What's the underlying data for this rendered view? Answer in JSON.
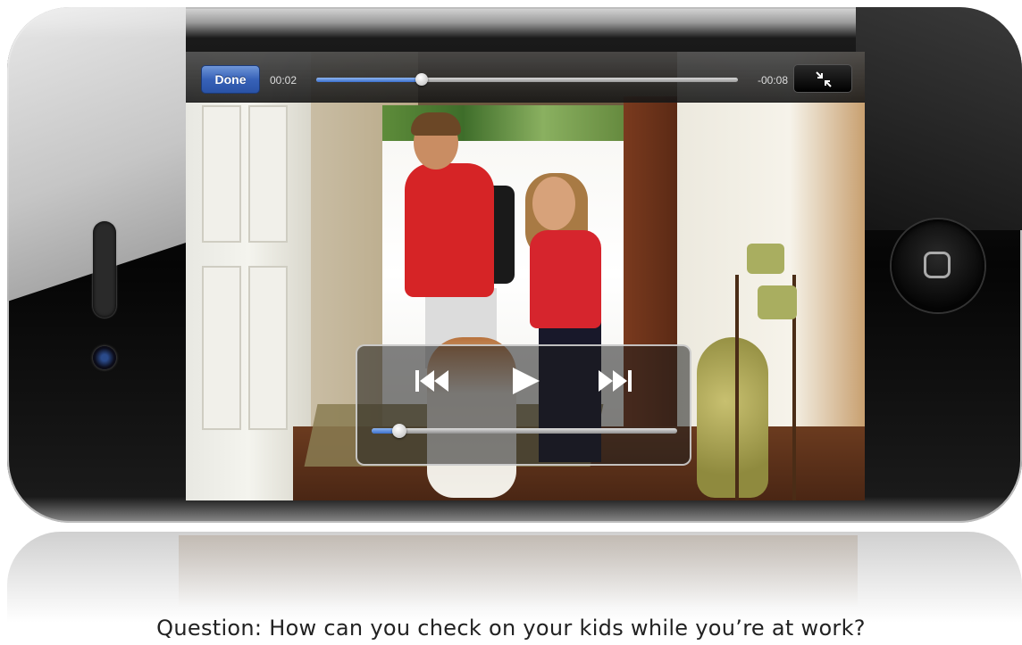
{
  "player": {
    "done_label": "Done",
    "elapsed_time": "00:02",
    "remaining_time": "-00:08",
    "playback_progress": 0.25,
    "volume_level": 0.09
  },
  "icons": {
    "fullscreen": "exit-fullscreen-icon",
    "previous": "skip-back-icon",
    "play": "play-icon",
    "next": "skip-forward-icon",
    "home": "home-button-icon"
  },
  "colors": {
    "done_button": "#3762b8",
    "progress_fill": "#3b6fcc"
  },
  "caption": "Question: How can you check on your kids while you’re at work?"
}
